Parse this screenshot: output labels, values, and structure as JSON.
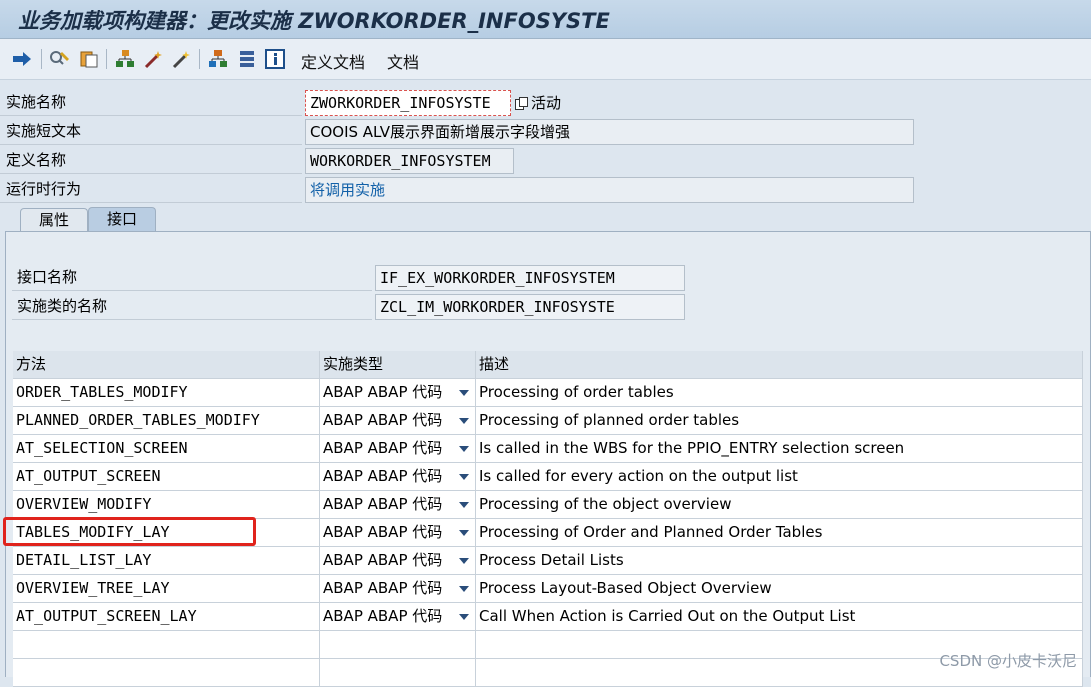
{
  "window": {
    "title": "业务加载项构建器：更改实施 ZWORKORDER_INFOSYSTE"
  },
  "toolbar": {
    "buttons": [
      {
        "icon": "arrow-right-icon"
      },
      {
        "icon": "display-change-icon"
      },
      {
        "icon": "copy-icon"
      },
      {
        "icon": "hierarchy-icon"
      },
      {
        "icon": "magic-wand-icon"
      },
      {
        "icon": "activate-wand-icon"
      },
      {
        "icon": "org-structure-icon"
      },
      {
        "icon": "stack-icon"
      },
      {
        "icon": "info-icon"
      }
    ],
    "definition_doc_label": "定义文档",
    "doc_label": "文档"
  },
  "header": {
    "impl_name_label": "实施名称",
    "impl_name_value": "ZWORKORDER_INFOSYSTE",
    "status_text": "活动",
    "short_text_label": "实施短文本",
    "short_text_value": "COOIS ALV展示界面新增展示字段增强",
    "definition_name_label": "定义名称",
    "definition_name_value": "WORKORDER_INFOSYSTEM",
    "runtime_behavior_label": "运行时行为",
    "runtime_behavior_value": "将调用实施"
  },
  "tabs": [
    {
      "label": "属性",
      "active": false
    },
    {
      "label": "接口",
      "active": true
    }
  ],
  "interface": {
    "interface_name_label": "接口名称",
    "interface_name_value": "IF_EX_WORKORDER_INFOSYSTEM",
    "impl_class_label": "实施类的名称",
    "impl_class_value": "ZCL_IM_WORKORDER_INFOSYSTE"
  },
  "methods_table": {
    "columns": [
      "方法",
      "实施类型",
      "描述"
    ],
    "rows": [
      {
        "method": "ORDER_TABLES_MODIFY",
        "type": "ABAP ABAP 代码",
        "desc": "Processing of order tables"
      },
      {
        "method": "PLANNED_ORDER_TABLES_MODIFY",
        "type": "ABAP ABAP 代码",
        "desc": "Processing of planned order tables"
      },
      {
        "method": "AT_SELECTION_SCREEN",
        "type": "ABAP ABAP 代码",
        "desc": "Is called in the WBS for the PPIO_ENTRY selection screen"
      },
      {
        "method": "AT_OUTPUT_SCREEN",
        "type": "ABAP ABAP 代码",
        "desc": "Is called for every action on the output list"
      },
      {
        "method": "OVERVIEW_MODIFY",
        "type": "ABAP ABAP 代码",
        "desc": "Processing of the object overview"
      },
      {
        "method": "TABLES_MODIFY_LAY",
        "type": "ABAP ABAP 代码",
        "desc": "Processing of Order and Planned Order Tables"
      },
      {
        "method": "DETAIL_LIST_LAY",
        "type": "ABAP ABAP 代码",
        "desc": "Process Detail Lists"
      },
      {
        "method": "OVERVIEW_TREE_LAY",
        "type": "ABAP ABAP 代码",
        "desc": "Process Layout-Based Object Overview"
      },
      {
        "method": "AT_OUTPUT_SCREEN_LAY",
        "type": "ABAP ABAP 代码",
        "desc": "Call When Action is Carried Out on the Output List"
      }
    ],
    "highlighted_row_index": 5
  },
  "colors": {
    "highlight": "#e0231c",
    "link": "#1160a8"
  },
  "watermark": "CSDN @小皮卡沃尼"
}
